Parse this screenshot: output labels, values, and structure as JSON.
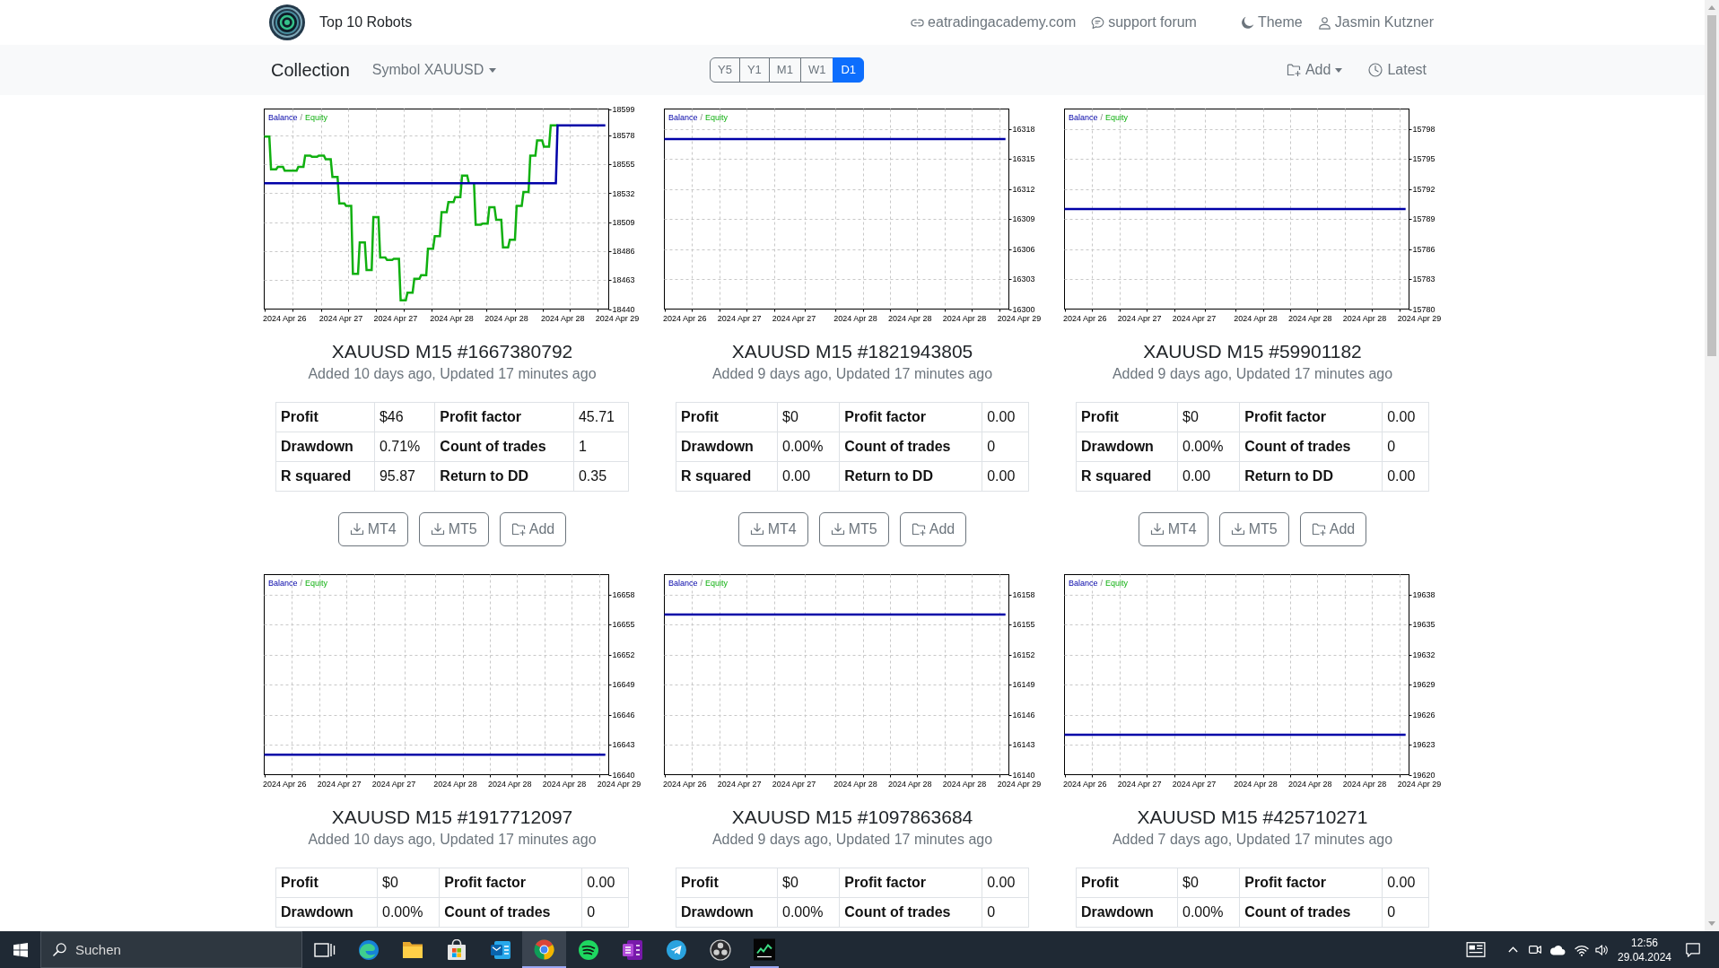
{
  "navbar": {
    "brand": "Top 10 Robots",
    "links": [
      {
        "kind": "website",
        "label": "eatradingacademy.com"
      },
      {
        "kind": "forum",
        "label": "support forum"
      }
    ],
    "controls": [
      {
        "kind": "theme",
        "label": "Theme"
      },
      {
        "kind": "account",
        "label": "Jasmin Kutzner"
      }
    ]
  },
  "toolbar": {
    "title": "Collection",
    "symbol_menu": "Symbol XAUUSD",
    "periods": [
      {
        "label": "Y5",
        "selected": false
      },
      {
        "label": "Y1",
        "selected": false
      },
      {
        "label": "M1",
        "selected": false
      },
      {
        "label": "W1",
        "selected": false
      },
      {
        "label": "D1",
        "selected": true
      }
    ],
    "actions": [
      {
        "kind": "add-menu",
        "label": "Add"
      },
      {
        "kind": "latest",
        "label": "Latest"
      }
    ]
  },
  "robots": [
    {
      "title": "XAUUSD M15 #1667380792",
      "subtitle": "Added 10 days ago, Updated 17 minutes ago",
      "legend_separator": "/",
      "chart_data": {
        "type": "line",
        "grid": true,
        "categories": [
          null,
          null,
          null,
          null,
          null,
          null,
          null,
          null,
          null,
          null,
          null,
          null,
          "2024 Apr 26",
          null,
          null,
          null,
          null,
          null,
          null,
          null,
          null,
          null,
          null,
          null,
          null,
          null,
          null,
          null,
          null,
          null,
          null,
          null,
          null,
          null,
          null,
          null,
          null,
          null,
          null,
          null,
          null,
          null,
          null,
          null,
          null,
          "2024 Apr 27",
          null,
          null,
          null,
          null,
          null,
          null,
          null,
          null,
          null,
          null,
          null,
          null,
          null,
          null,
          null,
          null,
          null,
          null,
          null,
          null,
          null,
          null,
          null,
          null,
          null,
          null,
          null,
          null,
          null,
          null,
          null,
          "2024 Apr 27",
          null,
          null,
          null,
          null,
          null,
          null,
          null,
          null,
          null,
          null,
          null,
          null,
          null,
          null,
          null,
          null,
          null,
          null,
          null,
          null,
          null,
          null,
          null,
          null,
          null,
          null,
          null,
          null,
          null,
          null,
          null,
          null,
          "2024 Apr 28",
          null,
          null,
          null,
          null,
          null,
          null,
          null,
          null,
          null,
          null,
          null,
          null,
          null,
          null,
          null,
          null,
          null,
          null,
          null,
          null,
          null,
          null,
          null,
          null,
          null,
          null,
          null,
          null,
          null,
          null,
          null,
          "2024 Apr 28",
          null,
          null,
          null,
          null,
          null,
          null,
          null,
          null,
          null,
          null,
          null,
          null,
          null,
          null,
          null,
          null,
          null,
          null,
          null,
          null,
          null,
          null,
          null,
          null,
          null,
          null,
          null,
          null,
          null,
          null,
          null,
          null,
          "2024 Apr 28",
          null,
          null,
          null,
          null,
          null,
          null,
          null,
          null,
          null,
          null,
          null,
          null,
          null,
          null,
          null,
          null,
          null,
          null,
          null,
          null,
          null,
          null,
          null,
          null,
          null,
          null,
          null,
          null,
          null,
          null,
          null,
          "2024 Apr 29"
        ],
        "series": [
          {
            "name": "Balance",
            "color": "#0000a8",
            "values": [
              18540,
              18540,
              18540,
              18540,
              18540,
              18540,
              18540,
              18540,
              18540,
              18540,
              18540,
              18540,
              18540,
              18540,
              18540,
              18540,
              18540,
              18540,
              18540,
              18540,
              18540,
              18540,
              18540,
              18540,
              18540,
              18540,
              18540,
              18540,
              18540,
              18540,
              18540,
              18540,
              18540,
              18540,
              18540,
              18540,
              18540,
              18540,
              18540,
              18540,
              18540,
              18540,
              18540,
              18540,
              18540,
              18540,
              18540,
              18540,
              18540,
              18540,
              18540,
              18540,
              18540,
              18540,
              18540,
              18540,
              18540,
              18540,
              18540,
              18540,
              18540,
              18540,
              18540,
              18540,
              18540,
              18540,
              18540,
              18540,
              18540,
              18540,
              18540,
              18540,
              18540,
              18540,
              18540,
              18540,
              18540,
              18540,
              18540,
              18540,
              18540,
              18540,
              18540,
              18540,
              18540,
              18540,
              18540,
              18540,
              18540,
              18540,
              18540,
              18540,
              18540,
              18540,
              18540,
              18540,
              18540,
              18540,
              18540,
              18540,
              18540,
              18540,
              18540,
              18540,
              18540,
              18540,
              18540,
              18540,
              18540,
              18540,
              18540,
              18540,
              18540,
              18540,
              18540,
              18540,
              18540,
              18540,
              18540,
              18540,
              18540,
              18540,
              18540,
              18540,
              18540,
              18540,
              18540,
              18540,
              18540,
              18540,
              18540,
              18540,
              18540,
              18540,
              18540,
              18540,
              18540,
              18540,
              18540,
              18540,
              18540,
              18540,
              18540,
              18540,
              18540,
              18540,
              18540,
              18540,
              18540,
              18540,
              18540,
              18540,
              18540,
              18540,
              18540,
              18540,
              18540,
              18540,
              18540,
              18540,
              18540,
              18540,
              18540,
              18540,
              18540,
              18540,
              18540,
              18540,
              18540,
              18540,
              18540,
              18540,
              18586,
              18586,
              18586,
              18586,
              18586,
              18586,
              18586,
              18586,
              18586,
              18586,
              18586,
              18586,
              18586,
              18586,
              18586,
              18586,
              18586,
              18586,
              18586,
              18586,
              18586,
              18586,
              18586,
              18586,
              18586,
              18586,
              18586,
              18586,
              18586,
              null,
              null,
              null,
              null,
              null,
              null,
              null
            ]
          },
          {
            "name": "Equity",
            "color": "#10b010",
            "values": [
              18577,
              18577,
              18577,
              18577,
              18551,
              18551,
              18551,
              18551,
              18553,
              18553,
              18553,
              18553,
              18550,
              18550,
              18550,
              18550,
              18550,
              18550,
              18550,
              18550,
              18553,
              18553,
              18553,
              18553,
              18562,
              18562,
              18562,
              18562,
              18561,
              18561,
              18561,
              18561,
              18562,
              18562,
              18562,
              18562,
              18559,
              18559,
              18559,
              18559,
              18545,
              18545,
              18545,
              18545,
              18524,
              18524,
              18524,
              18524,
              18522,
              18522,
              18522,
              18522,
              18468,
              18468,
              18468,
              18468,
              18493,
              18493,
              18493,
              18493,
              18471,
              18471,
              18471,
              18471,
              18513,
              18513,
              18513,
              18513,
              18481,
              18481,
              18481,
              18481,
              18479,
              18479,
              18479,
              18479,
              18480,
              18480,
              18480,
              18480,
              18447,
              18447,
              18447,
              18447,
              18453,
              18453,
              18453,
              18453,
              18464,
              18464,
              18464,
              18464,
              18467,
              18467,
              18467,
              18467,
              18488,
              18488,
              18488,
              18488,
              18498,
              18498,
              18498,
              18498,
              18517,
              18517,
              18517,
              18517,
              18525,
              18525,
              18525,
              18525,
              18529,
              18529,
              18529,
              18529,
              18546,
              18546,
              18546,
              18546,
              18540,
              null,
              null,
              18540,
              18507,
              18507,
              18507,
              18507,
              18508,
              18508,
              18508,
              18508,
              18521,
              18521,
              18521,
              18521,
              18511,
              18511,
              18511,
              18511,
              18489,
              18489,
              18489,
              18489,
              18495,
              18495,
              18495,
              18495,
              18522,
              18522,
              18522,
              18522,
              18533,
              18533,
              18533,
              18533,
              18562,
              18562,
              18562,
              18562,
              18574,
              18574,
              18574,
              18574,
              18569,
              18569,
              18569,
              18569,
              18586,
              18586,
              18586,
              18586,
              18586,
              null,
              null,
              null,
              null,
              null,
              null,
              null,
              null,
              null,
              null,
              null,
              null,
              null,
              null,
              null,
              null,
              null,
              null,
              null,
              null,
              null,
              null,
              null,
              null,
              null,
              null,
              null,
              null,
              null,
              null,
              null,
              null,
              null,
              null,
              null
            ]
          }
        ],
        "ylim": [
          18440,
          18599
        ],
        "yticks": [
          18440,
          18463,
          18486,
          18509,
          18532,
          18555,
          18578,
          18599
        ]
      },
      "stats": [
        {
          "label": "Profit",
          "value": "$46"
        },
        {
          "label": "Profit factor",
          "value": "45.71"
        },
        {
          "label": "Drawdown",
          "value": "0.71%"
        },
        {
          "label": "Count of trades",
          "value": "1"
        },
        {
          "label": "R squared",
          "value": "95.87"
        },
        {
          "label": "Return to DD",
          "value": "0.35"
        }
      ],
      "buttons": [
        {
          "kind": "download",
          "label": "MT4"
        },
        {
          "kind": "download",
          "label": "MT5"
        },
        {
          "kind": "add",
          "label": "Add"
        }
      ]
    },
    {
      "title": "XAUUSD M15 #1821943805",
      "subtitle": "Added 9 days ago, Updated 17 minutes ago",
      "legend_separator": "/",
      "chart_data": {
        "type": "line",
        "grid": true,
        "categories": [
          null,
          null,
          null,
          "2024 Apr 26",
          null,
          null,
          null,
          null,
          null,
          null,
          null,
          "2024 Apr 27",
          null,
          null,
          null,
          null,
          null,
          null,
          null,
          "2024 Apr 27",
          null,
          null,
          null,
          null,
          null,
          null,
          null,
          null,
          "2024 Apr 28",
          null,
          null,
          null,
          null,
          null,
          null,
          null,
          "2024 Apr 28",
          null,
          null,
          null,
          null,
          null,
          null,
          null,
          "2024 Apr 28",
          null,
          null,
          null,
          null,
          null,
          null,
          null,
          "2024 Apr 29"
        ],
        "series": [
          {
            "name": "Balance",
            "color": "#0000a8",
            "values": [
              16317,
              16317,
              16317,
              16317,
              16317,
              16317,
              16317,
              16317,
              16317,
              16317,
              16317,
              16317,
              16317,
              16317,
              16317,
              16317,
              16317,
              16317,
              16317,
              16317,
              16317,
              16317,
              16317,
              16317,
              16317,
              16317,
              16317,
              16317,
              16317,
              16317,
              16317,
              16317,
              16317,
              16317,
              16317,
              16317,
              16317,
              16317,
              16317,
              16317,
              16317,
              16317,
              16317,
              16317,
              16317,
              16317,
              16317,
              16317,
              16317,
              16317,
              16317,
              null,
              null
            ]
          },
          {
            "name": "Equity",
            "color": "#10b010",
            "values": [
              null,
              null,
              null,
              null,
              null,
              null,
              null,
              null,
              null,
              null,
              null,
              null,
              null,
              null,
              null,
              null,
              null,
              null,
              null,
              null,
              null,
              null,
              null,
              null,
              null,
              null,
              null,
              null,
              null,
              null,
              null,
              null,
              null,
              null,
              null,
              null,
              null,
              null,
              null,
              null,
              null,
              null,
              null,
              null,
              null,
              null,
              null,
              null,
              null,
              null,
              null,
              null,
              null
            ]
          }
        ],
        "ylim": [
          16300,
          16320
        ],
        "yticks": [
          16300,
          16303,
          16306,
          16309,
          16312,
          16315,
          16318
        ]
      },
      "stats": [
        {
          "label": "Profit",
          "value": "$0"
        },
        {
          "label": "Profit factor",
          "value": "0.00"
        },
        {
          "label": "Drawdown",
          "value": "0.00%"
        },
        {
          "label": "Count of trades",
          "value": "0"
        },
        {
          "label": "R squared",
          "value": "0.00"
        },
        {
          "label": "Return to DD",
          "value": "0.00"
        }
      ],
      "buttons": [
        {
          "kind": "download",
          "label": "MT4"
        },
        {
          "kind": "download",
          "label": "MT5"
        },
        {
          "kind": "add",
          "label": "Add"
        }
      ]
    },
    {
      "title": "XAUUSD M15 #59901182",
      "subtitle": "Added 9 days ago, Updated 17 minutes ago",
      "legend_separator": "/",
      "chart_data": {
        "type": "line",
        "grid": true,
        "categories": [
          null,
          null,
          null,
          "2024 Apr 26",
          null,
          null,
          null,
          null,
          null,
          null,
          null,
          "2024 Apr 27",
          null,
          null,
          null,
          null,
          null,
          null,
          null,
          "2024 Apr 27",
          null,
          null,
          null,
          null,
          null,
          null,
          null,
          null,
          "2024 Apr 28",
          null,
          null,
          null,
          null,
          null,
          null,
          null,
          "2024 Apr 28",
          null,
          null,
          null,
          null,
          null,
          null,
          null,
          "2024 Apr 28",
          null,
          null,
          null,
          null,
          null,
          null,
          null,
          "2024 Apr 29"
        ],
        "series": [
          {
            "name": "Balance",
            "color": "#0000a8",
            "values": [
              15790,
              15790,
              15790,
              15790,
              15790,
              15790,
              15790,
              15790,
              15790,
              15790,
              15790,
              15790,
              15790,
              15790,
              15790,
              15790,
              15790,
              15790,
              15790,
              15790,
              15790,
              15790,
              15790,
              15790,
              15790,
              15790,
              15790,
              15790,
              15790,
              15790,
              15790,
              15790,
              15790,
              15790,
              15790,
              15790,
              15790,
              15790,
              15790,
              15790,
              15790,
              15790,
              15790,
              15790,
              15790,
              15790,
              15790,
              15790,
              15790,
              15790,
              15790,
              null,
              null
            ]
          },
          {
            "name": "Equity",
            "color": "#10b010",
            "values": [
              null,
              null,
              null,
              null,
              null,
              null,
              null,
              null,
              null,
              null,
              null,
              null,
              null,
              null,
              null,
              null,
              null,
              null,
              null,
              null,
              null,
              null,
              null,
              null,
              null,
              null,
              null,
              null,
              null,
              null,
              null,
              null,
              null,
              null,
              null,
              null,
              null,
              null,
              null,
              null,
              null,
              null,
              null,
              null,
              null,
              null,
              null,
              null,
              null,
              null,
              null,
              null,
              null
            ]
          }
        ],
        "ylim": [
          15780,
          15800
        ],
        "yticks": [
          15780,
          15783,
          15786,
          15789,
          15792,
          15795,
          15798
        ]
      },
      "stats": [
        {
          "label": "Profit",
          "value": "$0"
        },
        {
          "label": "Profit factor",
          "value": "0.00"
        },
        {
          "label": "Drawdown",
          "value": "0.00%"
        },
        {
          "label": "Count of trades",
          "value": "0"
        },
        {
          "label": "R squared",
          "value": "0.00"
        },
        {
          "label": "Return to DD",
          "value": "0.00"
        }
      ],
      "buttons": [
        {
          "kind": "download",
          "label": "MT4"
        },
        {
          "kind": "download",
          "label": "MT5"
        },
        {
          "kind": "add",
          "label": "Add"
        }
      ]
    },
    {
      "title": "XAUUSD M15 #1917712097",
      "subtitle": "Added 10 days ago, Updated 17 minutes ago",
      "legend_separator": "/",
      "chart_data": {
        "type": "line",
        "grid": true,
        "categories": [
          null,
          null,
          null,
          "2024 Apr 26",
          null,
          null,
          null,
          null,
          null,
          null,
          null,
          "2024 Apr 27",
          null,
          null,
          null,
          null,
          null,
          null,
          null,
          "2024 Apr 27",
          null,
          null,
          null,
          null,
          null,
          null,
          null,
          null,
          "2024 Apr 28",
          null,
          null,
          null,
          null,
          null,
          null,
          null,
          "2024 Apr 28",
          null,
          null,
          null,
          null,
          null,
          null,
          null,
          "2024 Apr 28",
          null,
          null,
          null,
          null,
          null,
          null,
          null,
          "2024 Apr 29"
        ],
        "series": [
          {
            "name": "Balance",
            "color": "#0000a8",
            "values": [
              16642,
              16642,
              16642,
              16642,
              16642,
              16642,
              16642,
              16642,
              16642,
              16642,
              16642,
              16642,
              16642,
              16642,
              16642,
              16642,
              16642,
              16642,
              16642,
              16642,
              16642,
              16642,
              16642,
              16642,
              16642,
              16642,
              16642,
              16642,
              16642,
              16642,
              16642,
              16642,
              16642,
              16642,
              16642,
              16642,
              16642,
              16642,
              16642,
              16642,
              16642,
              16642,
              16642,
              16642,
              16642,
              16642,
              16642,
              16642,
              16642,
              16642,
              16642,
              null,
              null
            ]
          },
          {
            "name": "Equity",
            "color": "#10b010",
            "values": [
              null,
              null,
              null,
              null,
              null,
              null,
              null,
              null,
              null,
              null,
              null,
              null,
              null,
              null,
              null,
              null,
              null,
              null,
              null,
              null,
              null,
              null,
              null,
              null,
              null,
              null,
              null,
              null,
              null,
              null,
              null,
              null,
              null,
              null,
              null,
              null,
              null,
              null,
              null,
              null,
              null,
              null,
              null,
              null,
              null,
              null,
              null,
              null,
              null,
              null,
              null,
              null,
              null
            ]
          }
        ],
        "ylim": [
          16640,
          16660
        ],
        "yticks": [
          16640,
          16643,
          16646,
          16649,
          16652,
          16655,
          16658
        ]
      },
      "stats": [
        {
          "label": "Profit",
          "value": "$0"
        },
        {
          "label": "Profit factor",
          "value": "0.00"
        },
        {
          "label": "Drawdown",
          "value": "0.00%"
        },
        {
          "label": "Count of trades",
          "value": "0"
        }
      ]
    },
    {
      "title": "XAUUSD M15 #1097863684",
      "subtitle": "Added 9 days ago, Updated 17 minutes ago",
      "legend_separator": "/",
      "chart_data": {
        "type": "line",
        "grid": true,
        "categories": [
          null,
          null,
          null,
          "2024 Apr 26",
          null,
          null,
          null,
          null,
          null,
          null,
          null,
          "2024 Apr 27",
          null,
          null,
          null,
          null,
          null,
          null,
          null,
          "2024 Apr 27",
          null,
          null,
          null,
          null,
          null,
          null,
          null,
          null,
          "2024 Apr 28",
          null,
          null,
          null,
          null,
          null,
          null,
          null,
          "2024 Apr 28",
          null,
          null,
          null,
          null,
          null,
          null,
          null,
          "2024 Apr 28",
          null,
          null,
          null,
          null,
          null,
          null,
          null,
          "2024 Apr 29"
        ],
        "series": [
          {
            "name": "Balance",
            "color": "#0000a8",
            "values": [
              16156,
              16156,
              16156,
              16156,
              16156,
              16156,
              16156,
              16156,
              16156,
              16156,
              16156,
              16156,
              16156,
              16156,
              16156,
              16156,
              16156,
              16156,
              16156,
              16156,
              16156,
              16156,
              16156,
              16156,
              16156,
              16156,
              16156,
              16156,
              16156,
              16156,
              16156,
              16156,
              16156,
              16156,
              16156,
              16156,
              16156,
              16156,
              16156,
              16156,
              16156,
              16156,
              16156,
              16156,
              16156,
              16156,
              16156,
              16156,
              16156,
              16156,
              16156,
              null,
              null
            ]
          },
          {
            "name": "Equity",
            "color": "#10b010",
            "values": [
              null,
              null,
              null,
              null,
              null,
              null,
              null,
              null,
              null,
              null,
              null,
              null,
              null,
              null,
              null,
              null,
              null,
              null,
              null,
              null,
              null,
              null,
              null,
              null,
              null,
              null,
              null,
              null,
              null,
              null,
              null,
              null,
              null,
              null,
              null,
              null,
              null,
              null,
              null,
              null,
              null,
              null,
              null,
              null,
              null,
              null,
              null,
              null,
              null,
              null,
              null,
              null,
              null
            ]
          }
        ],
        "ylim": [
          16140,
          16160
        ],
        "yticks": [
          16140,
          16143,
          16146,
          16149,
          16152,
          16155,
          16158
        ]
      },
      "stats": [
        {
          "label": "Profit",
          "value": "$0"
        },
        {
          "label": "Profit factor",
          "value": "0.00"
        },
        {
          "label": "Drawdown",
          "value": "0.00%"
        },
        {
          "label": "Count of trades",
          "value": "0"
        }
      ]
    },
    {
      "title": "XAUUSD M15 #425710271",
      "subtitle": "Added 7 days ago, Updated 17 minutes ago",
      "legend_separator": "/",
      "chart_data": {
        "type": "line",
        "grid": true,
        "categories": [
          null,
          null,
          null,
          "2024 Apr 26",
          null,
          null,
          null,
          null,
          null,
          null,
          null,
          "2024 Apr 27",
          null,
          null,
          null,
          null,
          null,
          null,
          null,
          "2024 Apr 27",
          null,
          null,
          null,
          null,
          null,
          null,
          null,
          null,
          "2024 Apr 28",
          null,
          null,
          null,
          null,
          null,
          null,
          null,
          "2024 Apr 28",
          null,
          null,
          null,
          null,
          null,
          null,
          null,
          "2024 Apr 28",
          null,
          null,
          null,
          null,
          null,
          null,
          null,
          "2024 Apr 29"
        ],
        "series": [
          {
            "name": "Balance",
            "color": "#0000a8",
            "values": [
              19624,
              19624,
              19624,
              19624,
              19624,
              19624,
              19624,
              19624,
              19624,
              19624,
              19624,
              19624,
              19624,
              19624,
              19624,
              19624,
              19624,
              19624,
              19624,
              19624,
              19624,
              19624,
              19624,
              19624,
              19624,
              19624,
              19624,
              19624,
              19624,
              19624,
              19624,
              19624,
              19624,
              19624,
              19624,
              19624,
              19624,
              19624,
              19624,
              19624,
              19624,
              19624,
              19624,
              19624,
              19624,
              19624,
              19624,
              19624,
              19624,
              19624,
              19624,
              null,
              null
            ]
          },
          {
            "name": "Equity",
            "color": "#10b010",
            "values": [
              null,
              null,
              null,
              null,
              null,
              null,
              null,
              null,
              null,
              null,
              null,
              null,
              null,
              null,
              null,
              null,
              null,
              null,
              null,
              null,
              null,
              null,
              null,
              null,
              null,
              null,
              null,
              null,
              null,
              null,
              null,
              null,
              null,
              null,
              null,
              null,
              null,
              null,
              null,
              null,
              null,
              null,
              null,
              null,
              null,
              null,
              null,
              null,
              null,
              null,
              null,
              null,
              null
            ]
          }
        ],
        "ylim": [
          19620,
          19640
        ],
        "yticks": [
          19620,
          19623,
          19626,
          19629,
          19632,
          19635,
          19638
        ]
      },
      "stats": [
        {
          "label": "Profit",
          "value": "$0"
        },
        {
          "label": "Profit factor",
          "value": "0.00"
        },
        {
          "label": "Drawdown",
          "value": "0.00%"
        },
        {
          "label": "Count of trades",
          "value": "0"
        }
      ]
    }
  ],
  "taskbar": {
    "search": {
      "placeholder": "Suchen"
    },
    "apps": [
      {
        "kind": "task-view",
        "selected": false,
        "running": false
      },
      {
        "kind": "swirl-browser",
        "selected": false,
        "running": false
      },
      {
        "kind": "folder",
        "selected": false,
        "running": false
      },
      {
        "kind": "store",
        "selected": false,
        "running": false
      },
      {
        "kind": "mail",
        "selected": false,
        "running": false
      },
      {
        "kind": "round-browser",
        "selected": true,
        "running": true
      },
      {
        "kind": "music",
        "selected": false,
        "running": false
      },
      {
        "kind": "notebook",
        "selected": false,
        "running": false
      },
      {
        "kind": "messenger",
        "selected": false,
        "running": false
      },
      {
        "kind": "recorder",
        "selected": false,
        "running": false
      },
      {
        "kind": "trading",
        "selected": false,
        "running": true
      }
    ],
    "time": "12:56",
    "date": "29.04.2024"
  }
}
